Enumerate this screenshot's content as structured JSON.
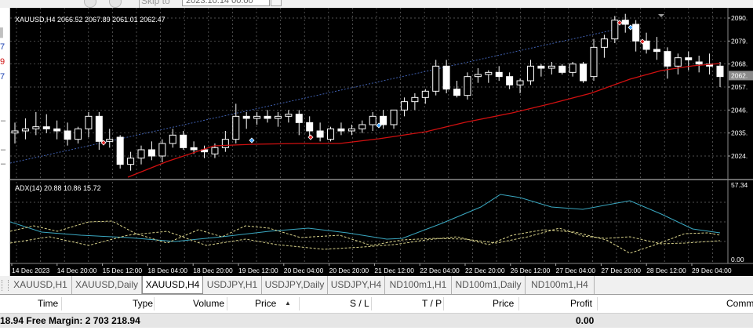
{
  "toolbar": {
    "skip_to_label": "Skip to",
    "date_value": "2023.10.14 00:00"
  },
  "left_panel": {
    "fragments": [
      "7",
      "9",
      "7"
    ]
  },
  "chart": {
    "symbol_info": "XAUUSD,H4  2066.52 2067.89 2061.01 2062.47",
    "indicator_info": "ADX(14) 20.88 10.86 15.72",
    "price_labels": [
      "2090.",
      "2079.",
      "2068.",
      "2057.",
      "2046.",
      "2035.",
      "2024."
    ],
    "current_price": "2062.",
    "indicator_labels": [
      "57.34",
      "0.00"
    ],
    "time_labels": [
      "14 Dec 2023",
      "14 Dec 20:00",
      "15 Dec 12:00",
      "18 Dec 04:00",
      "18 Dec 20:00",
      "19 Dec 12:00",
      "20 Dec 04:00",
      "20 Dec 20:00",
      "21 Dec 12:00",
      "22 Dec 04:00",
      "22 Dec 20:00",
      "26 Dec 12:00",
      "27 Dec 04:00",
      "27 Dec 20:00",
      "28 Dec 12:00",
      "29 Dec 04:00"
    ],
    "colors": {
      "background": "#000000",
      "grid": "#6b6b6b",
      "candle": "#ffffff",
      "ma_line": "#d01010",
      "adx_line": "#3aa7c0",
      "di_lines": "#d8d28a",
      "trend_line": "#3f5fae"
    }
  },
  "tabs": [
    {
      "label": "XAUUSD,H1",
      "active": false
    },
    {
      "label": "XAUUSD,Daily",
      "active": false
    },
    {
      "label": "XAUUSD,H4",
      "active": true
    },
    {
      "label": "USDJPY,H1",
      "active": false
    },
    {
      "label": "USDJPY,Daily",
      "active": false
    },
    {
      "label": "USDJPY,H4",
      "active": false
    },
    {
      "label": "ND100m1,H1",
      "active": false
    },
    {
      "label": "ND100m1,Daily",
      "active": false
    },
    {
      "label": "ND100m1,H4",
      "active": false
    }
  ],
  "table": {
    "columns": [
      "Time",
      "Type",
      "Volume",
      "Price",
      "S / L",
      "T / P",
      "Price",
      "Profit",
      "Comm"
    ]
  },
  "summary": {
    "text": "18.94  Free Margin: 2 703 218.94",
    "profit": "0.00"
  }
}
